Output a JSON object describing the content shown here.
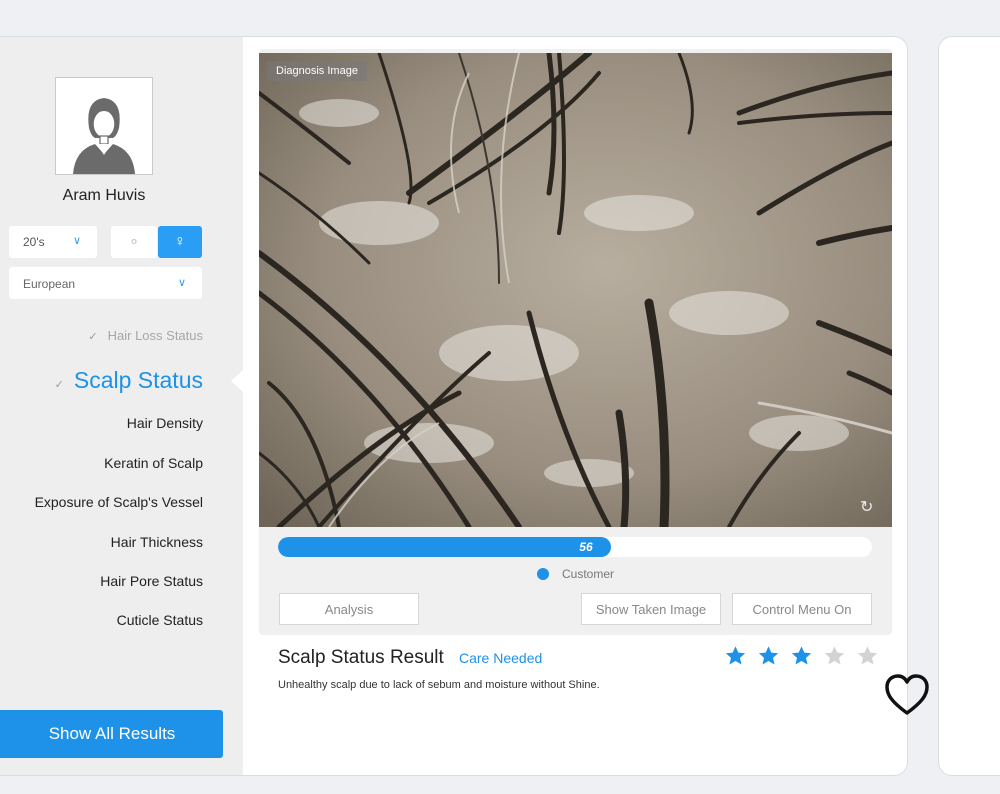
{
  "profile": {
    "name": "Aram Huvis",
    "age": "20's",
    "gender_male_icon": "male-icon",
    "gender_female_icon": "female-icon",
    "ethnicity": "European"
  },
  "nav": {
    "items": [
      {
        "label": "Hair Loss Status",
        "state": "done"
      },
      {
        "label": "Scalp Status",
        "state": "active"
      },
      {
        "label": "Hair Density"
      },
      {
        "label": "Keratin of Scalp"
      },
      {
        "label": "Exposure of Scalp's Vessel"
      },
      {
        "label": "Hair Thickness"
      },
      {
        "label": "Hair Pore Status"
      },
      {
        "label": "Cuticle Status"
      }
    ],
    "show_all": "Show All Results"
  },
  "diagnosis": {
    "image_label": "Diagnosis Image",
    "score": 56,
    "score_max": 100,
    "legend": "Customer",
    "buttons": {
      "analysis": "Analysis",
      "show_taken": "Show Taken Image",
      "control_menu": "Control Menu On"
    }
  },
  "result": {
    "title": "Scalp Status Result",
    "status": "Care Needed",
    "description": "Unhealthy scalp due to lack of sebum and moisture without Shine.",
    "rating": 3,
    "rating_max": 5
  },
  "colors": {
    "accent": "#1d92e8",
    "star_off": "#d3d3d3"
  }
}
